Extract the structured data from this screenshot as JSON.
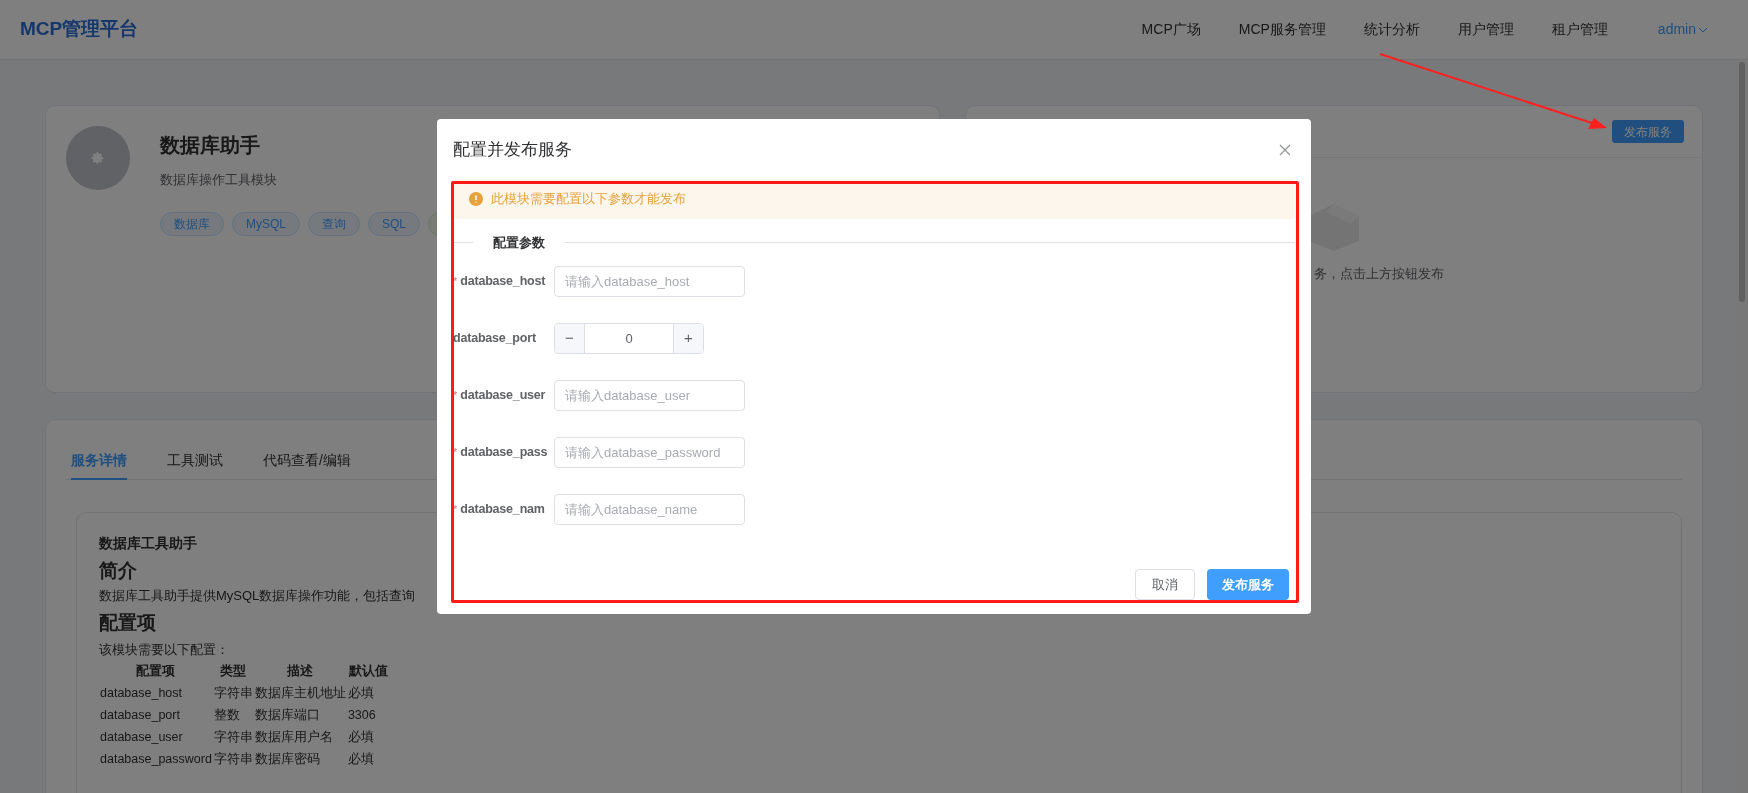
{
  "header": {
    "logo": "MCP管理平台",
    "nav": [
      {
        "label": "MCP广场",
        "selected": false
      },
      {
        "label": "MCP服务管理",
        "selected": false
      },
      {
        "label": "统计分析",
        "selected": false
      },
      {
        "label": "用户管理",
        "selected": false
      },
      {
        "label": "租户管理",
        "selected": false
      }
    ],
    "user": "admin"
  },
  "module_card": {
    "name": "数据库助手",
    "description": "数据库操作工具模块",
    "tags": [
      {
        "label": "数据库",
        "kind": "primary"
      },
      {
        "label": "MySQL",
        "kind": "primary"
      },
      {
        "label": "查询",
        "kind": "primary"
      },
      {
        "label": "SQL",
        "kind": "primary"
      },
      {
        "kind": "success"
      }
    ]
  },
  "services_card": {
    "publish_button": "发布服务",
    "empty_text": "务，点击上方按钮发布"
  },
  "detail_tabs": [
    {
      "label": "服务详情",
      "selected": true
    },
    {
      "label": "工具测试",
      "selected": false
    },
    {
      "label": "代码查看/编辑",
      "selected": false
    }
  ],
  "readme": {
    "title": "数据库工具助手",
    "intro_heading": "简介",
    "intro": "数据库工具助手提供MySQL数据库操作功能，包括查询",
    "config_heading": "配置项",
    "config_note": "该模块需要以下配置：",
    "columns": [
      "配置项",
      "类型",
      "描述",
      "默认值"
    ],
    "rows": [
      [
        "database_host",
        "字符串",
        "数据库主机地址",
        "必填"
      ],
      [
        "database_port",
        "整数",
        "数据库端口",
        "3306"
      ],
      [
        "database_user",
        "字符串",
        "数据库用户名",
        "必填"
      ],
      [
        "database_password",
        "字符串",
        "数据库密码",
        "必填"
      ]
    ]
  },
  "dialog": {
    "title": "配置并发布服务",
    "alert": "此模块需要配置以下参数才能发布",
    "section": "配置参数",
    "required_mark": "*",
    "fields": [
      {
        "label": "database_host",
        "required": true,
        "kind": "text",
        "placeholder": "请输入database_host"
      },
      {
        "label": "database_port",
        "required": false,
        "kind": "number",
        "value": "0",
        "minus": "−",
        "plus": "+"
      },
      {
        "label": "database_user",
        "required": true,
        "kind": "text",
        "placeholder": "请输入database_user"
      },
      {
        "label": "database_pass",
        "required": true,
        "kind": "text",
        "placeholder": "请输入database_password"
      },
      {
        "label": "database_nam",
        "required": true,
        "kind": "text",
        "placeholder": "请输入database_name"
      }
    ],
    "cancel": "取消",
    "submit": "发布服务"
  }
}
